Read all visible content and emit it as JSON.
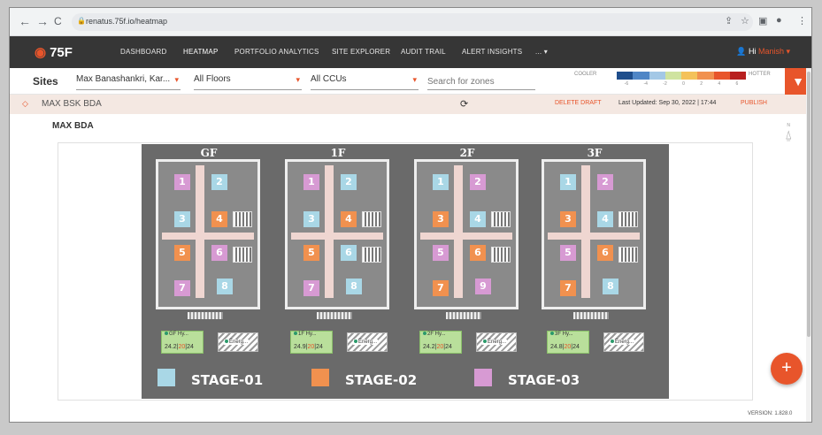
{
  "browser": {
    "url": "renatus.75f.io/heatmap",
    "back": "←",
    "forward": "→",
    "reload": "C",
    "icons": [
      "share-icon",
      "star-icon",
      "sidebar-icon",
      "profile-icon",
      "kebab-menu-icon"
    ]
  },
  "app": {
    "logo": "75F",
    "nav": [
      "DASHBOARD",
      "HEATMAP",
      "PORTFOLIO ANALYTICS",
      "SITE EXPLORER",
      "AUDIT TRAIL",
      "ALERT INSIGHTS",
      "..."
    ],
    "active_nav": "HEATMAP",
    "user_greeting": "Hi",
    "user_name": "Manish"
  },
  "filters": {
    "sites_label": "Sites",
    "site": "Max Banashankri, Kar...",
    "floors": "All Floors",
    "ccus": "All CCUs",
    "search_placeholder": "Search for zones"
  },
  "legend": {
    "cooler": "COOLER",
    "hotter": "HOTTER",
    "ticks": [
      "-6",
      "-4",
      "-2",
      "0",
      "2",
      "4",
      "6"
    ],
    "colors": [
      "#1f4e8c",
      "#4f86c6",
      "#a3c8e6",
      "#cfe3a0",
      "#f4c25a",
      "#f1914f",
      "#e8552b",
      "#b81f1f"
    ]
  },
  "site_row": {
    "name": "MAX BSK BDA",
    "delete_draft": "DELETE DRAFT",
    "last_updated": "Last Updated: Sep 30, 2022 | 17:44",
    "publish": "PUBLISH"
  },
  "main": {
    "title": "MAX BDA",
    "compass": "N"
  },
  "floors": [
    {
      "label": "GF",
      "zones": [
        {
          "n": "1",
          "c": "pink"
        },
        {
          "n": "2",
          "c": "blue"
        },
        {
          "n": "3",
          "c": "blue"
        },
        {
          "n": "4",
          "c": "orange"
        },
        {
          "n": "5",
          "c": "orange"
        },
        {
          "n": "6",
          "c": "pink"
        },
        {
          "n": "7",
          "c": "pink"
        },
        {
          "n": "8",
          "c": "blue"
        }
      ],
      "ccu": {
        "name": "GF Hy...",
        "temps": [
          "24.2",
          "20",
          "24"
        ]
      },
      "energy": "Energ..."
    },
    {
      "label": "1F",
      "zones": [
        {
          "n": "1",
          "c": "pink"
        },
        {
          "n": "2",
          "c": "blue"
        },
        {
          "n": "3",
          "c": "blue"
        },
        {
          "n": "4",
          "c": "orange"
        },
        {
          "n": "5",
          "c": "orange"
        },
        {
          "n": "6",
          "c": "blue"
        },
        {
          "n": "7",
          "c": "pink"
        },
        {
          "n": "8",
          "c": "blue"
        }
      ],
      "ccu": {
        "name": "1F Hy...",
        "temps": [
          "24.9",
          "20",
          "24"
        ]
      },
      "energy": "Energ..."
    },
    {
      "label": "2F",
      "zones": [
        {
          "n": "1",
          "c": "blue"
        },
        {
          "n": "2",
          "c": "pink"
        },
        {
          "n": "3",
          "c": "orange"
        },
        {
          "n": "4",
          "c": "blue"
        },
        {
          "n": "5",
          "c": "pink"
        },
        {
          "n": "6",
          "c": "orange"
        },
        {
          "n": "7",
          "c": "orange"
        },
        {
          "n": "9",
          "c": "pink"
        }
      ],
      "ccu": {
        "name": "2F Hy...",
        "temps": [
          "24.2",
          "20",
          "24"
        ]
      },
      "energy": "Energ..."
    },
    {
      "label": "3F",
      "zones": [
        {
          "n": "1",
          "c": "blue"
        },
        {
          "n": "2",
          "c": "pink"
        },
        {
          "n": "3",
          "c": "orange"
        },
        {
          "n": "4",
          "c": "blue"
        },
        {
          "n": "5",
          "c": "pink"
        },
        {
          "n": "6",
          "c": "orange"
        },
        {
          "n": "7",
          "c": "orange"
        },
        {
          "n": "8",
          "c": "blue"
        }
      ],
      "ccu": {
        "name": "3F Hy...",
        "temps": [
          "24.8",
          "20",
          "24"
        ]
      },
      "energy": "Energ..."
    }
  ],
  "stages": [
    {
      "label": "STAGE-01",
      "color": "#a9d7e6"
    },
    {
      "label": "STAGE-02",
      "color": "#f1914f"
    },
    {
      "label": "STAGE-03",
      "color": "#d79ad3"
    }
  ],
  "fab": "+",
  "version": "VERSION: 1.828.0"
}
